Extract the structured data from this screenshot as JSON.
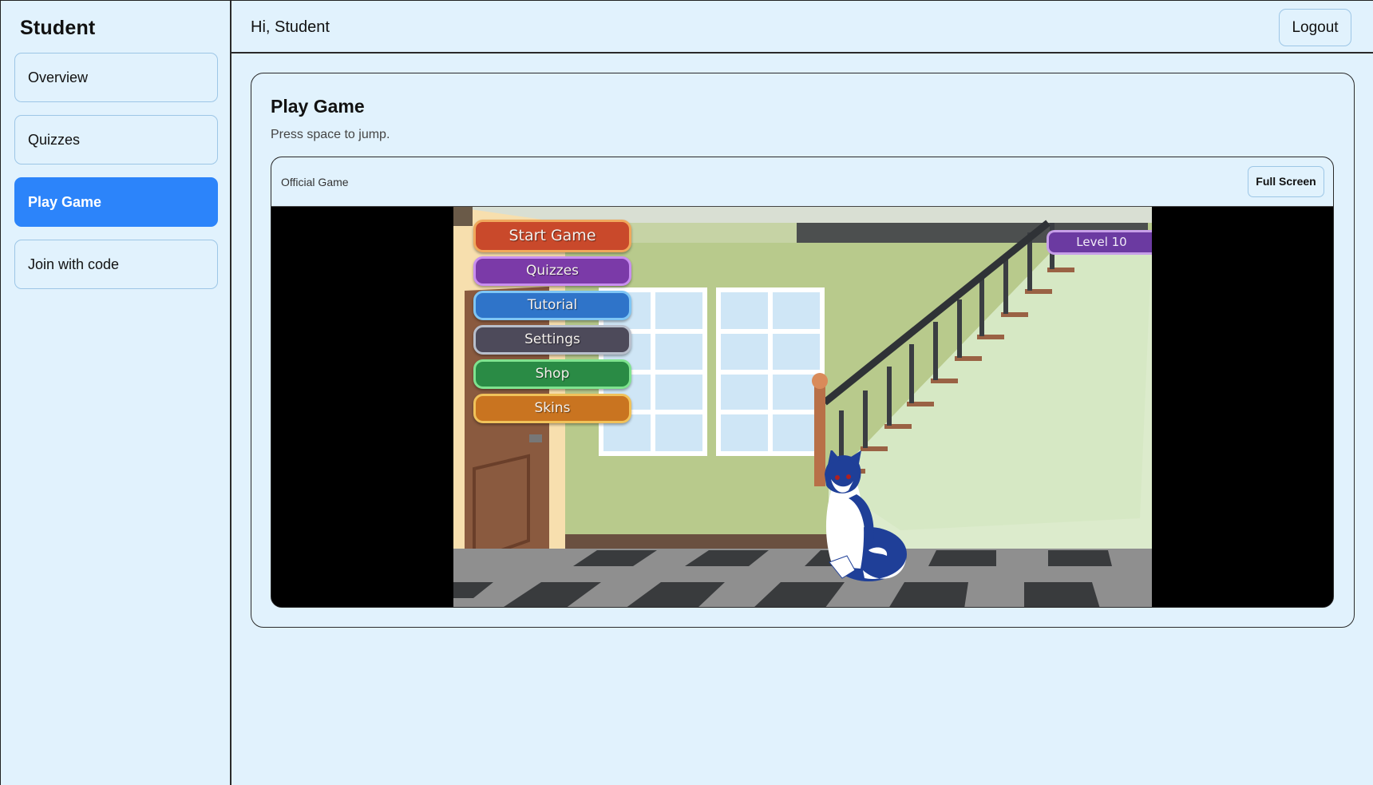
{
  "sidebar": {
    "title": "Student",
    "items": [
      {
        "label": "Overview",
        "active": false
      },
      {
        "label": "Quizzes",
        "active": false
      },
      {
        "label": "Play Game",
        "active": true
      },
      {
        "label": "Join with code",
        "active": false
      }
    ]
  },
  "header": {
    "greeting": "Hi, Student",
    "logout_label": "Logout"
  },
  "main": {
    "title": "Play Game",
    "subtitle": "Press space to jump.",
    "panel": {
      "label": "Official Game",
      "fullscreen_label": "Full Screen"
    },
    "game": {
      "menu": {
        "start": "Start Game",
        "quizzes": "Quizzes",
        "tutorial": "Tutorial",
        "settings": "Settings",
        "shop": "Shop",
        "skins": "Skins"
      },
      "level": "Level 10"
    }
  },
  "colors": {
    "background": "#e1f2fd",
    "accent": "#2c84fa",
    "start_button": "#c9492b",
    "quizzes_button": "#7b3aa8",
    "tutorial_button": "#2f74c9",
    "settings_button": "#4d4a5a",
    "shop_button": "#2a8b45",
    "skins_button": "#c97420"
  }
}
